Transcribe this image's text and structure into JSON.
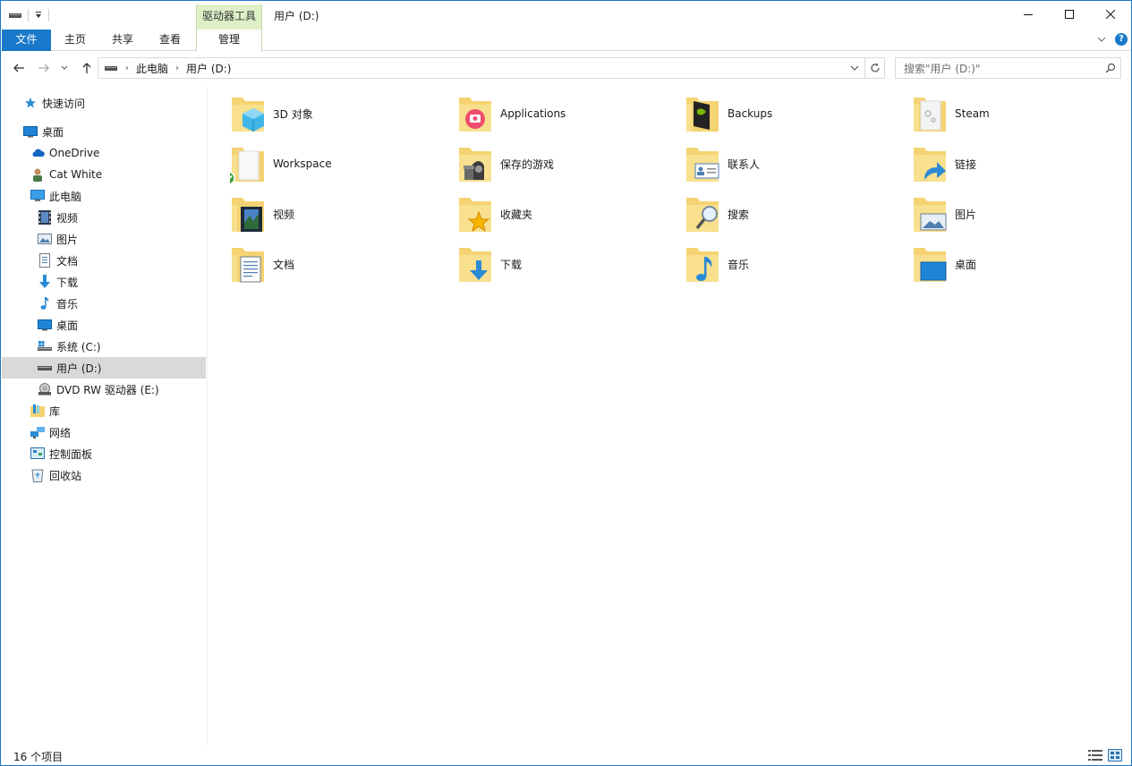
{
  "window": {
    "title": "用户 (D:)",
    "context_tool": "驱动器工具"
  },
  "ribbon": {
    "tabs": [
      "文件",
      "主页",
      "共享",
      "查看"
    ],
    "manage_tab": "管理"
  },
  "address": {
    "crumbs": [
      "此电脑",
      "用户 (D:)"
    ],
    "search_placeholder": "搜索\"用户 (D:)\""
  },
  "sidebar": {
    "items": [
      {
        "label": "快速访问",
        "icon": "star-icon"
      },
      {
        "label": "桌面",
        "icon": "desktop-icon"
      },
      {
        "label": "OneDrive",
        "icon": "cloud-icon"
      },
      {
        "label": "Cat White",
        "icon": "user-icon"
      },
      {
        "label": "此电脑",
        "icon": "computer-icon"
      },
      {
        "label": "视频",
        "icon": "video-icon"
      },
      {
        "label": "图片",
        "icon": "picture-icon"
      },
      {
        "label": "文档",
        "icon": "document-icon"
      },
      {
        "label": "下载",
        "icon": "download-icon"
      },
      {
        "label": "音乐",
        "icon": "music-icon"
      },
      {
        "label": "桌面",
        "icon": "desktop-icon"
      },
      {
        "label": "系统 (C:)",
        "icon": "system-drive-icon"
      },
      {
        "label": "用户 (D:)",
        "icon": "drive-icon",
        "selected": true
      },
      {
        "label": "DVD RW 驱动器 (E:)",
        "icon": "dvd-icon"
      },
      {
        "label": "库",
        "icon": "library-icon"
      },
      {
        "label": "网络",
        "icon": "network-icon"
      },
      {
        "label": "控制面板",
        "icon": "control-panel-icon"
      },
      {
        "label": "回收站",
        "icon": "recycle-bin-icon"
      }
    ]
  },
  "folders": [
    {
      "name": "3D 对象",
      "icon": "3d-objects-icon"
    },
    {
      "name": "Applications",
      "icon": "applications-icon"
    },
    {
      "name": "Backups",
      "icon": "backups-icon"
    },
    {
      "name": "Steam",
      "icon": "steam-icon"
    },
    {
      "name": "Workspace",
      "icon": "workspace-synced-icon"
    },
    {
      "name": "保存的游戏",
      "icon": "saved-games-icon"
    },
    {
      "name": "联系人",
      "icon": "contacts-icon"
    },
    {
      "name": "链接",
      "icon": "links-icon"
    },
    {
      "name": "视频",
      "icon": "video-icon"
    },
    {
      "name": "收藏夹",
      "icon": "favorites-icon"
    },
    {
      "name": "搜索",
      "icon": "search-icon"
    },
    {
      "name": "图片",
      "icon": "picture-icon"
    },
    {
      "name": "文档",
      "icon": "document-icon"
    },
    {
      "name": "下载",
      "icon": "download-icon"
    },
    {
      "name": "音乐",
      "icon": "music-icon"
    },
    {
      "name": "桌面",
      "icon": "desktop-icon"
    }
  ],
  "status": {
    "item_count": "16 个项目"
  },
  "colors": {
    "accent": "#1979ca",
    "folder": "#f5d372",
    "context_tool": "#dff0c8",
    "selection": "#d9d9d9"
  }
}
